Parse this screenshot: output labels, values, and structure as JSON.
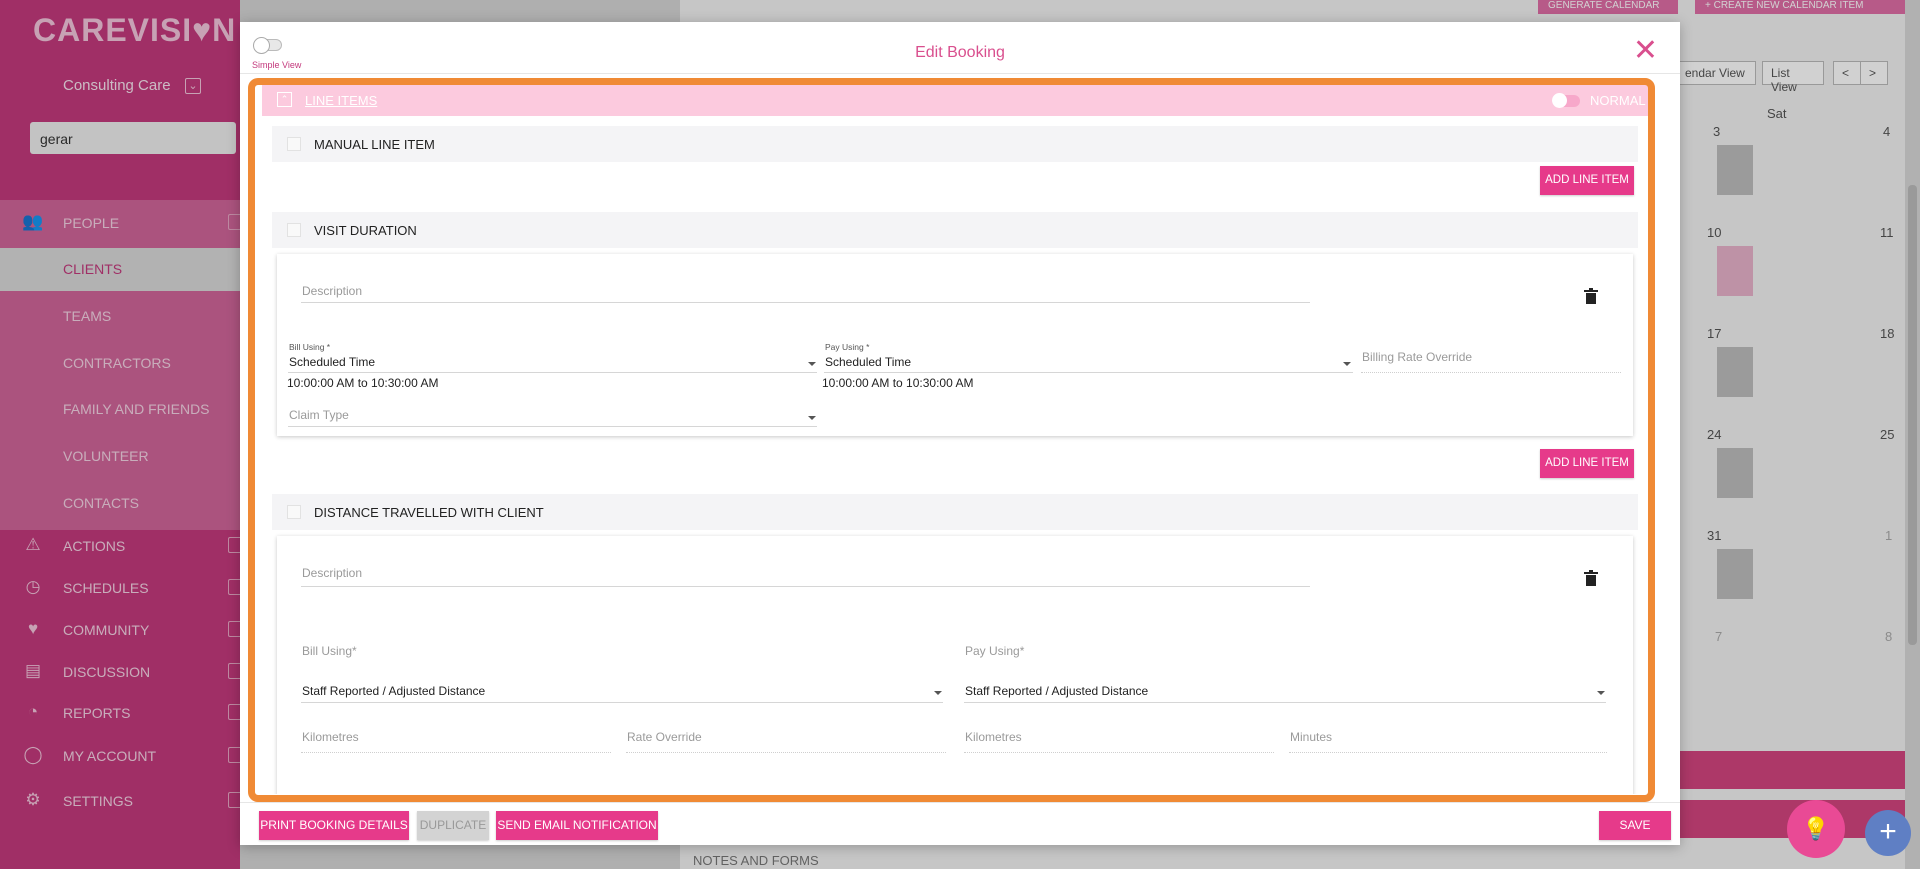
{
  "app": {
    "logo": "CAREVISI♥N",
    "org_name": "Consulting Care",
    "search_value": "gerar"
  },
  "nav": [
    {
      "label": "PEOPLE",
      "icon": "people-icon",
      "glyph": "👥"
    },
    {
      "label": "CLIENTS"
    },
    {
      "label": "TEAMS"
    },
    {
      "label": "CONTRACTORS"
    },
    {
      "label": "FAMILY AND FRIENDS"
    },
    {
      "label": "VOLUNTEER"
    },
    {
      "label": "CONTACTS"
    },
    {
      "label": "ACTIONS",
      "icon": "warning-icon",
      "glyph": "⚠"
    },
    {
      "label": "SCHEDULES",
      "icon": "clock-check-icon",
      "glyph": "◷"
    },
    {
      "label": "COMMUNITY",
      "icon": "hearts-icon",
      "glyph": "♥"
    },
    {
      "label": "DISCUSSION",
      "icon": "chat-icon",
      "glyph": "▤"
    },
    {
      "label": "REPORTS",
      "icon": "chart-icon",
      "glyph": "◔"
    },
    {
      "label": "MY ACCOUNT",
      "icon": "user-icon",
      "glyph": "◯"
    },
    {
      "label": "SETTINGS",
      "icon": "gear-icon",
      "glyph": "⚙"
    }
  ],
  "calendar": {
    "top_buttons": [
      "GENERATE CALENDAR",
      "+ CREATE NEW CALENDAR ITEM"
    ],
    "view_buttons": [
      "endar View",
      "List View"
    ],
    "prev": "<",
    "next": ">",
    "weekday": "Sat",
    "days": [
      "3",
      "4",
      "10",
      "11",
      "17",
      "18",
      "24",
      "25",
      "31",
      "1",
      "7",
      "8"
    ],
    "notes_label": "NOTES AND FORMS"
  },
  "modal": {
    "title": "Edit Booking",
    "simple_view_label": "Simple View",
    "close_glyph": "✕",
    "line_items": {
      "title": "LINE ITEMS",
      "mode_label": "NORMAL"
    },
    "sections": {
      "manual": "MANUAL LINE ITEM",
      "visit": "VISIT DURATION",
      "distance": "DISTANCE TRAVELLED WITH CLIENT"
    },
    "add_line_item": "ADD LINE ITEM",
    "visit_card": {
      "description_placeholder": "Description",
      "bill_using_label": "Bill Using *",
      "bill_using_value": "Scheduled Time",
      "bill_time_range": "10:00:00 AM to 10:30:00 AM",
      "pay_using_label": "Pay Using *",
      "pay_using_value": "Scheduled Time",
      "pay_time_range": "10:00:00 AM to 10:30:00 AM",
      "billing_rate_override": "Billing Rate Override",
      "claim_type": "Claim Type"
    },
    "distance_card": {
      "description_placeholder": "Description",
      "bill_using_label": "Bill Using*",
      "bill_using_value": "Staff Reported / Adjusted Distance",
      "pay_using_label": "Pay Using*",
      "pay_using_value": "Staff Reported / Adjusted Distance",
      "kilometres_1": "Kilometres",
      "rate_override": "Rate Override",
      "kilometres_2": "Kilometres",
      "minutes": "Minutes"
    },
    "footer": {
      "print": "PRINT BOOKING DETAILS",
      "duplicate": "DUPLICATE",
      "send_email": "SEND EMAIL NOTIFICATION",
      "save": "SAVE"
    }
  },
  "fab": {
    "lightbulb_glyph": "💡",
    "plus_glyph": "+"
  },
  "colors": {
    "brand": "#c43a7d",
    "button": "#e63a8a",
    "highlight": "#f08a35",
    "line_items_header": "#fccade"
  }
}
